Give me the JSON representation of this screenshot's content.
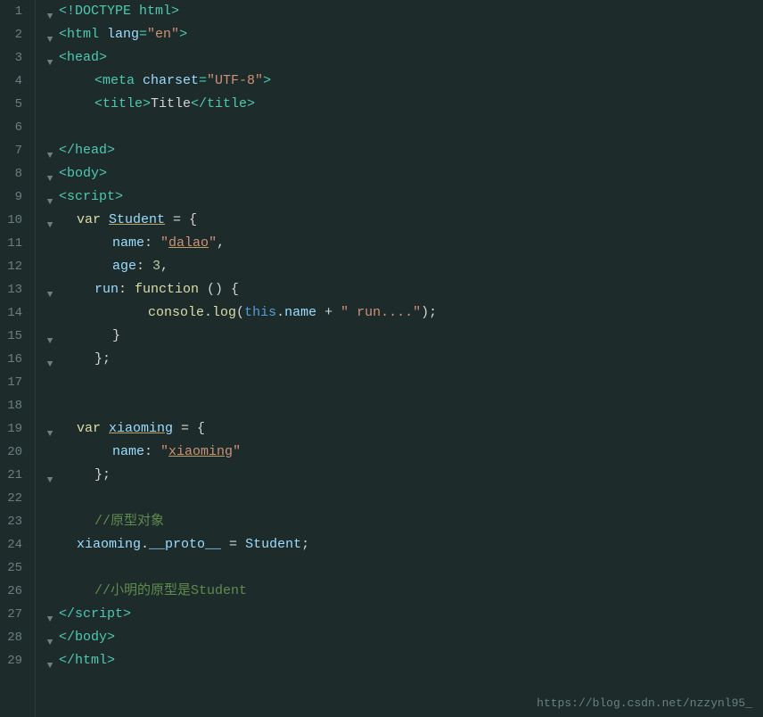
{
  "editor": {
    "background": "#1e2b2b",
    "watermark": "https://blog.csdn.net/nzzynl95_"
  },
  "lines": [
    {
      "num": 1,
      "fold": true,
      "content": "html_doctype"
    },
    {
      "num": 2,
      "fold": true,
      "content": "html_open"
    },
    {
      "num": 3,
      "fold": true,
      "content": "head_open"
    },
    {
      "num": 4,
      "fold": false,
      "content": "meta"
    },
    {
      "num": 5,
      "fold": false,
      "content": "title"
    },
    {
      "num": 6,
      "fold": false,
      "content": "empty"
    },
    {
      "num": 7,
      "fold": true,
      "content": "head_close"
    },
    {
      "num": 8,
      "fold": true,
      "content": "body_open"
    },
    {
      "num": 9,
      "fold": true,
      "content": "script_open"
    },
    {
      "num": 10,
      "fold": true,
      "content": "var_student"
    },
    {
      "num": 11,
      "fold": false,
      "content": "name_prop"
    },
    {
      "num": 12,
      "fold": false,
      "content": "age_prop"
    },
    {
      "num": 13,
      "fold": true,
      "content": "run_prop"
    },
    {
      "num": 14,
      "fold": false,
      "content": "console_log"
    },
    {
      "num": 15,
      "fold": true,
      "content": "brace_close"
    },
    {
      "num": 16,
      "fold": true,
      "content": "obj_end"
    },
    {
      "num": 17,
      "fold": false,
      "content": "empty"
    },
    {
      "num": 18,
      "fold": false,
      "content": "empty"
    },
    {
      "num": 19,
      "fold": true,
      "content": "var_xiaoming"
    },
    {
      "num": 20,
      "fold": false,
      "content": "name_xiaoming"
    },
    {
      "num": 21,
      "fold": true,
      "content": "obj_end2"
    },
    {
      "num": 22,
      "fold": false,
      "content": "empty"
    },
    {
      "num": 23,
      "fold": false,
      "content": "comment_proto"
    },
    {
      "num": 24,
      "fold": false,
      "content": "proto_assign"
    },
    {
      "num": 25,
      "fold": false,
      "content": "empty"
    },
    {
      "num": 26,
      "fold": false,
      "content": "comment_xiaoming"
    },
    {
      "num": 27,
      "fold": true,
      "content": "script_close"
    },
    {
      "num": 28,
      "fold": true,
      "content": "body_close"
    },
    {
      "num": 29,
      "fold": true,
      "content": "html_close"
    }
  ]
}
